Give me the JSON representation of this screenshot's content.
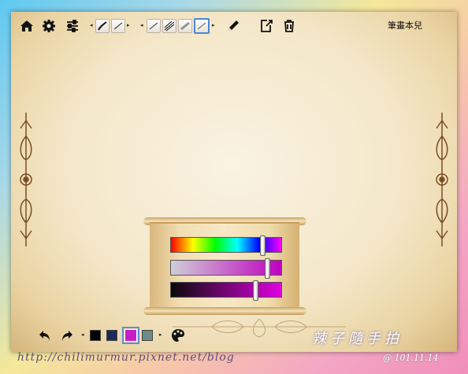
{
  "app": {
    "title": "筆畫本兒"
  },
  "toolbar": {
    "icons": [
      "home-icon",
      "gear-icon",
      "sliders-icon",
      "pencil-icon",
      "new-page-icon",
      "trash-icon"
    ],
    "brush_count": 6
  },
  "palette": {
    "sliders": [
      {
        "name": "hue",
        "value": 0.84,
        "colors": [
          "#ff0000",
          "#ffff00",
          "#00ff00",
          "#00ffff",
          "#0000ff",
          "#ff00ff"
        ]
      },
      {
        "name": "saturation",
        "value": 0.88,
        "colors": [
          "#cfcfd6",
          "#c000c0"
        ]
      },
      {
        "name": "brightness",
        "value": 0.77,
        "colors": [
          "#0a0a0a",
          "#e000e0"
        ]
      }
    ]
  },
  "bottombar": {
    "swatches": [
      "#000000",
      "#1c2a5a",
      "#c81ec8",
      "#6f8a8a"
    ],
    "selected_swatch": 2,
    "icons": [
      "undo-icon",
      "redo-icon",
      "palette-icon"
    ]
  },
  "footer": {
    "url": "http://chilimurmur.pixnet.net/blog",
    "date": "@ 101.11.14",
    "signature": "辣子隨手拍"
  }
}
